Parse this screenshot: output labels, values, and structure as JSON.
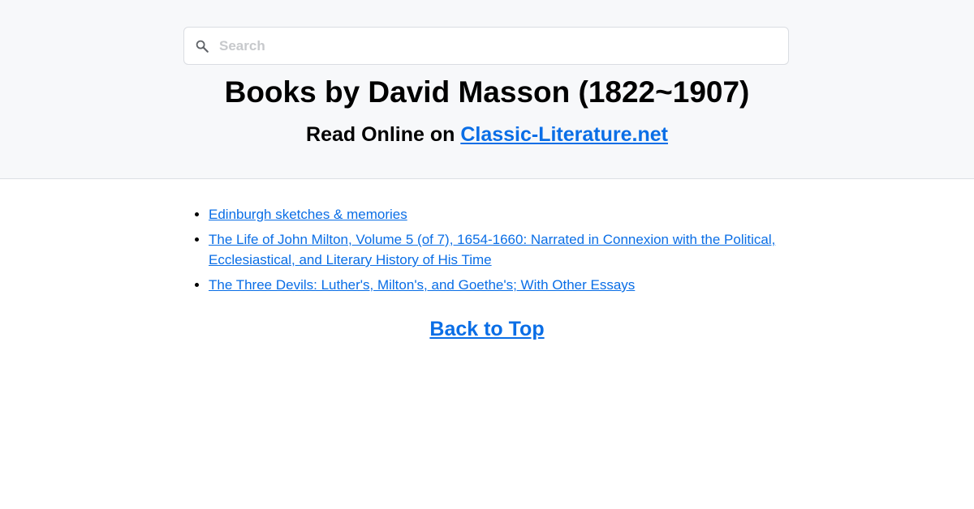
{
  "search": {
    "placeholder": "Search",
    "icon": "search-icon"
  },
  "header": {
    "title": "Books by David Masson (1822~1907)",
    "subtitle_prefix": "Read Online on ",
    "site_link": "Classic-Literature.net"
  },
  "books": [
    "Edinburgh sketches & memories",
    "The Life of John Milton, Volume 5 (of 7), 1654-1660: Narrated in Connexion with the Political, Ecclesiastical, and Literary History of His Time",
    "The Three Devils: Luther's, Milton's, and Goethe's; With Other Essays"
  ],
  "footer": {
    "back_to_top": "Back to Top"
  },
  "colors": {
    "link": "#0a6ee6",
    "header_bg": "#f7f8fa"
  }
}
